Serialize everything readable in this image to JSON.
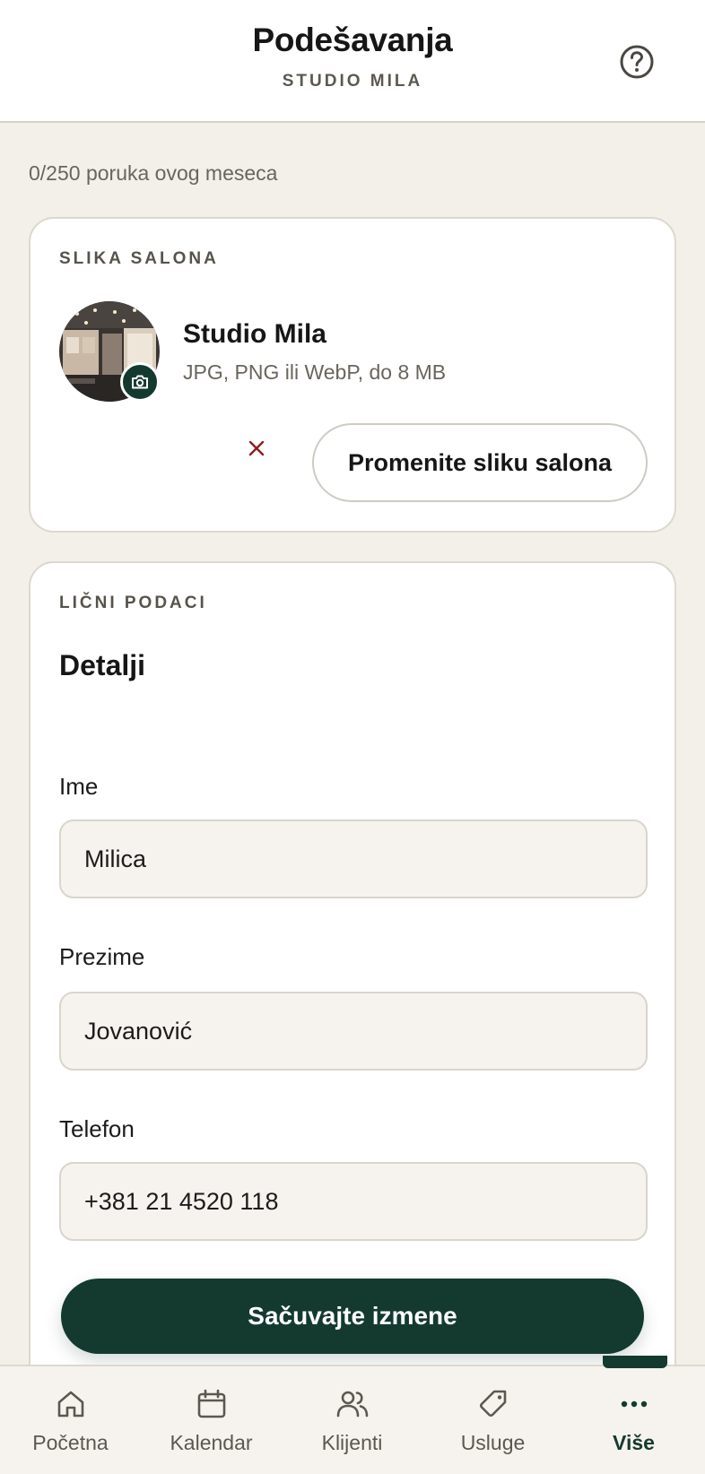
{
  "header": {
    "title": "Podešavanja",
    "subtitle": "STUDIO MILA",
    "help_icon": "help-circle-icon"
  },
  "counter_text": "0/250 poruka ovog meseca",
  "salon_photo": {
    "section_label": "SLIKA SALONA",
    "salon_name": "Studio Mila",
    "hint": "JPG, PNG ili WebP, do 8 MB",
    "camera_icon": "camera-icon",
    "remove_icon": "close-icon",
    "change_button": "Promenite sliku salona"
  },
  "personal": {
    "section_label": "LIČNI PODACI",
    "title": "Detalji",
    "fields": [
      {
        "label": "Ime",
        "value": "Milica"
      },
      {
        "label": "Prezime",
        "value": "Jovanović"
      },
      {
        "label": "Telefon",
        "value": "+381 21 4520 118"
      }
    ],
    "save_button": "Sačuvajte izmene"
  },
  "nav": {
    "items": [
      {
        "label": "Početna",
        "icon": "home-icon"
      },
      {
        "label": "Kalendar",
        "icon": "calendar-icon"
      },
      {
        "label": "Klijenti",
        "icon": "users-icon"
      },
      {
        "label": "Usluge",
        "icon": "tag-icon"
      },
      {
        "label": "Više",
        "icon": "more-icon",
        "active": true
      }
    ]
  },
  "colors": {
    "accent": "#143a2f",
    "background": "#f3f0ea",
    "danger": "#8b1e1e"
  }
}
